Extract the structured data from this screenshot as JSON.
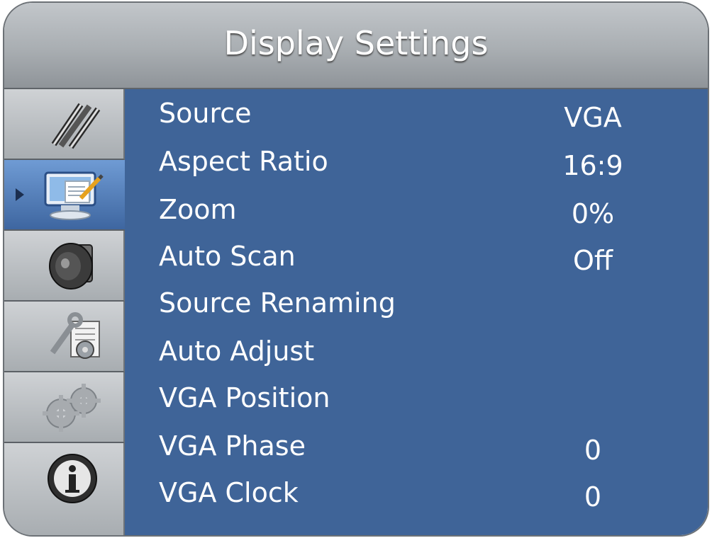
{
  "title": "Display Settings",
  "sidebar": {
    "items": [
      {
        "icon": "pencils-icon",
        "active": false
      },
      {
        "icon": "display-settings-icon",
        "active": true
      },
      {
        "icon": "speaker-icon",
        "active": false
      },
      {
        "icon": "tools-icon",
        "active": false
      },
      {
        "icon": "gears-icon",
        "active": false
      },
      {
        "icon": "info-icon",
        "active": false
      }
    ]
  },
  "menu": {
    "rows": [
      {
        "label": "Source",
        "value": "VGA"
      },
      {
        "label": "Aspect Ratio",
        "value": "16:9"
      },
      {
        "label": "Zoom",
        "value": "0%"
      },
      {
        "label": "Auto Scan",
        "value": "Off"
      },
      {
        "label": "Source Renaming",
        "value": ""
      },
      {
        "label": "Auto Adjust",
        "value": ""
      },
      {
        "label": "VGA Position",
        "value": ""
      },
      {
        "label": "VGA Phase",
        "value": "0"
      },
      {
        "label": "VGA Clock",
        "value": "0"
      }
    ]
  },
  "colors": {
    "content_bg": "#3f6498",
    "active_tab": "#4f7ab5",
    "text": "#ffffff"
  }
}
